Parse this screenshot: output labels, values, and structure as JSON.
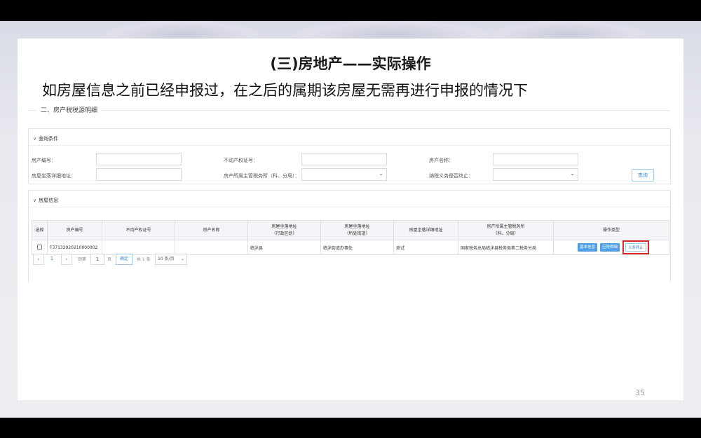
{
  "slide": {
    "title": "(三)房地产——实际操作",
    "subtitle": "如房屋信息之前已经申报过，在之后的属期该房屋无需再进行申报的情况下",
    "page_number": "35"
  },
  "section": {
    "title": "二、房产税税源明细"
  },
  "query": {
    "header": "查询条件",
    "fields": {
      "property_no": "房产编号：",
      "cert_no": "不动产权证号：",
      "property_name": "房产名称：",
      "address": "房屋坐落详细地址：",
      "tax_office": "房产所属主管税务所（科、分局）：",
      "obligation_end": "纳税义务是否终止："
    },
    "search_button": "查询"
  },
  "house": {
    "header": "房屋信息",
    "columns": {
      "select": "选择",
      "property_no": "房产编号",
      "cert_no": "不动产权证号",
      "property_name": "房产名称",
      "location_admin_1": "房屋坐落地址",
      "location_admin_2": "（行政区划）",
      "location_street_1": "房屋坐落地址",
      "location_street_2": "（所处街道）",
      "detail_address": "房屋坐落详细地址",
      "tax_office_1": "房产所属主管税务所",
      "tax_office_2": "（科、分局）",
      "operation": "操作类型"
    },
    "row": {
      "property_no": "F371329202100000​02",
      "cert_no": "",
      "property_name": "",
      "location_admin": "临沭县",
      "location_street": "临沭街道办事处",
      "detail_address": "测试",
      "tax_office": "国家税务总局临沭县税务局第二税务分局"
    },
    "actions": {
      "basic_info": "基本信息",
      "detail": "应税明细",
      "terminate": "义务终止"
    }
  },
  "pagination": {
    "current": "1",
    "goto_label": "到第",
    "goto_value": "1",
    "page_label": "页",
    "confirm": "确定",
    "total": "共 1 条",
    "per_page": "10 条/页"
  }
}
